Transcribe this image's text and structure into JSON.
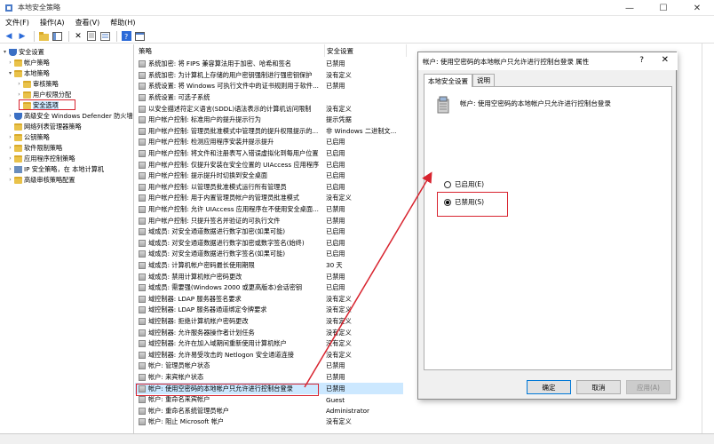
{
  "window": {
    "title": "本地安全策略",
    "minimize": "—",
    "maximize": "☐",
    "close": "✕"
  },
  "menu": [
    "文件(F)",
    "操作(A)",
    "查看(V)",
    "帮助(H)"
  ],
  "tree": {
    "items": [
      {
        "label": "安全设置",
        "level": 0,
        "expander": "▾",
        "icon": "shield"
      },
      {
        "label": "帐户策略",
        "level": 1,
        "expander": "›",
        "icon": "folder"
      },
      {
        "label": "本地策略",
        "level": 1,
        "expander": "▾",
        "icon": "folder"
      },
      {
        "label": "审核策略",
        "level": 2,
        "expander": "›",
        "icon": "folder"
      },
      {
        "label": "用户权限分配",
        "level": 2,
        "expander": "›",
        "icon": "folder"
      },
      {
        "label": "安全选项",
        "level": 2,
        "expander": "",
        "icon": "folder",
        "selected": true
      },
      {
        "label": "高级安全 Windows Defender 防火墙",
        "level": 1,
        "expander": "›",
        "icon": "shield"
      },
      {
        "label": "网络列表管理器策略",
        "level": 1,
        "expander": "",
        "icon": "folder"
      },
      {
        "label": "公钥策略",
        "level": 1,
        "expander": "›",
        "icon": "folder"
      },
      {
        "label": "软件限制策略",
        "level": 1,
        "expander": "›",
        "icon": "folder"
      },
      {
        "label": "应用程序控制策略",
        "level": 1,
        "expander": "›",
        "icon": "folder"
      },
      {
        "label": "IP 安全策略，在 本地计算机",
        "level": 1,
        "expander": "›",
        "icon": "network"
      },
      {
        "label": "高级审核策略配置",
        "level": 1,
        "expander": "›",
        "icon": "folder"
      }
    ]
  },
  "policy_list": {
    "col_policy": "策略",
    "col_setting": "安全设置",
    "rows": [
      {
        "name": "系统加密: 将 FIPS 兼容算法用于加密、哈希和签名",
        "setting": "已禁用"
      },
      {
        "name": "系统加密: 为计算机上存储的用户密钥强制进行强密钥保护",
        "setting": "没有定义"
      },
      {
        "name": "系统设置: 将 Windows 可执行文件中的证书规则用于软件...",
        "setting": "已禁用"
      },
      {
        "name": "系统设置: 可选子系统",
        "setting": ""
      },
      {
        "name": "以安全描述符定义语言(SDDL)语法表示的计算机访问限制",
        "setting": "没有定义"
      },
      {
        "name": "用户帐户控制: 标准用户的提升提示行为",
        "setting": "提示凭据"
      },
      {
        "name": "用户帐户控制: 管理员批准模式中管理员的提升权限提示的...",
        "setting": "非 Windows 二进制文..."
      },
      {
        "name": "用户帐户控制: 检测应用程序安装并提示提升",
        "setting": "已启用"
      },
      {
        "name": "用户帐户控制: 将文件和注册表写入错误虚拟化到每用户位置",
        "setting": "已启用"
      },
      {
        "name": "用户帐户控制: 仅提升安装在安全位置的 UIAccess 应用程序",
        "setting": "已启用"
      },
      {
        "name": "用户帐户控制: 提示提升时切换到安全桌面",
        "setting": "已启用"
      },
      {
        "name": "用户帐户控制: 以管理员批准模式运行所有管理员",
        "setting": "已启用"
      },
      {
        "name": "用户帐户控制: 用于内置管理员帐户的管理员批准模式",
        "setting": "没有定义"
      },
      {
        "name": "用户帐户控制: 允许 UIAccess 应用程序在不使用安全桌面...",
        "setting": "已禁用"
      },
      {
        "name": "用户帐户控制: 只提升签名并验证的可执行文件",
        "setting": "已禁用"
      },
      {
        "name": "域成员: 对安全通道数据进行数字加密(如果可能)",
        "setting": "已启用"
      },
      {
        "name": "域成员: 对安全通道数据进行数字加密或数字签名(始终)",
        "setting": "已启用"
      },
      {
        "name": "域成员: 对安全通道数据进行数字签名(如果可能)",
        "setting": "已启用"
      },
      {
        "name": "域成员: 计算机帐户密码最长使用期限",
        "setting": "30 天"
      },
      {
        "name": "域成员: 禁用计算机帐户密码更改",
        "setting": "已禁用"
      },
      {
        "name": "域成员: 需要强(Windows 2000 或更高版本)会话密钥",
        "setting": "已启用"
      },
      {
        "name": "域控制器: LDAP 服务器签名要求",
        "setting": "没有定义"
      },
      {
        "name": "域控制器: LDAP 服务器通道绑定令牌要求",
        "setting": "没有定义"
      },
      {
        "name": "域控制器: 拒绝计算机帐户密码更改",
        "setting": "没有定义"
      },
      {
        "name": "域控制器: 允许服务器操作者计划任务",
        "setting": "没有定义"
      },
      {
        "name": "域控制器: 允许在加入域期间重新使用计算机帐户",
        "setting": "没有定义"
      },
      {
        "name": "域控制器: 允许易受攻击的 Netlogon 安全通道连接",
        "setting": "没有定义"
      },
      {
        "name": "帐户: 管理员帐户状态",
        "setting": "已禁用"
      },
      {
        "name": "帐户: 来宾帐户状态",
        "setting": "已禁用"
      },
      {
        "name": "帐户: 使用空密码的本地帐户只允许进行控制台登录",
        "setting": "已禁用",
        "highlighted": true
      },
      {
        "name": "帐户: 重命名来宾帐户",
        "setting": "Guest"
      },
      {
        "name": "帐户: 重命名系统管理员帐户",
        "setting": "Administrator"
      },
      {
        "name": "帐户: 阻止 Microsoft 帐户",
        "setting": "没有定义"
      }
    ]
  },
  "dialog": {
    "title": "帐户: 使用空密码的本地帐户只允许进行控制台登录 属性",
    "help": "?",
    "close": "✕",
    "tabs": [
      "本地安全设置",
      "说明"
    ],
    "policy_title": "帐户: 使用空密码的本地帐户只允许进行控制台登录",
    "options": [
      {
        "label": "已启用(E)",
        "checked": false
      },
      {
        "label": "已禁用(S)",
        "checked": true
      }
    ],
    "buttons": {
      "ok": "确定",
      "cancel": "取消",
      "apply": "应用(A)"
    }
  },
  "colors": {
    "highlight_red": "#d8242f",
    "selection_blue": "#cce8ff",
    "accent": "#0078d7"
  }
}
